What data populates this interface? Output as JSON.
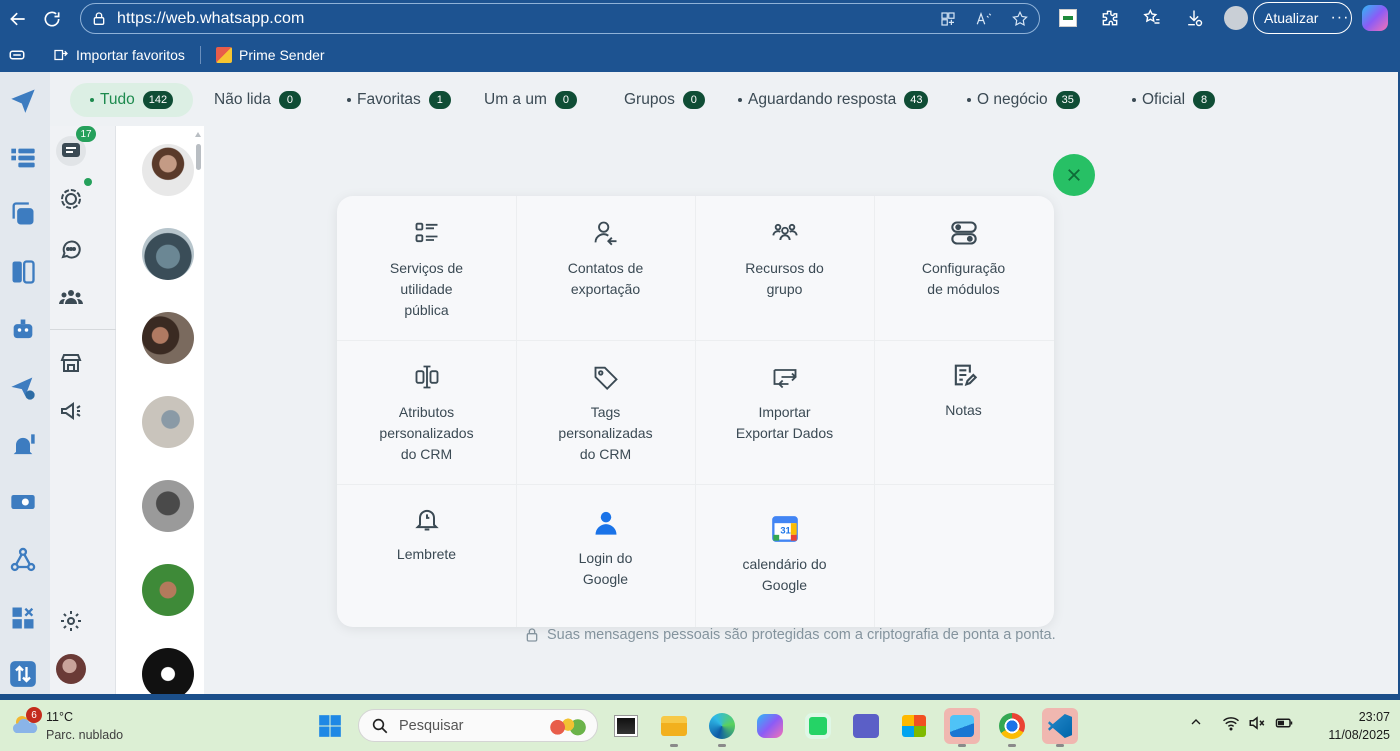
{
  "browser": {
    "url": "https://web.whatsapp.com",
    "update_label": "Atualizar",
    "more_label": "···",
    "bookmarks": [
      {
        "label": "Importar favoritos"
      },
      {
        "label": "Prime Sender"
      }
    ]
  },
  "filters": [
    {
      "label": "Tudo",
      "count": "142",
      "active": true,
      "dot": true
    },
    {
      "label": "Não lida",
      "count": "0",
      "dot": false
    },
    {
      "label": "Favoritas",
      "count": "1",
      "dot": true
    },
    {
      "label": "Um a um",
      "count": "0",
      "dot": false
    },
    {
      "label": "Grupos",
      "count": "0",
      "dot": false
    },
    {
      "label": "Aguardando resposta",
      "count": "43",
      "dot": true
    },
    {
      "label": "O negócio",
      "count": "35",
      "dot": true
    },
    {
      "label": "Oficial",
      "count": "8",
      "dot": true
    }
  ],
  "rail": {
    "chats_badge": "17"
  },
  "modal": {
    "items": [
      {
        "label": "Serviços de utilidade pública",
        "icon": "list-icon"
      },
      {
        "label": "Contatos de exportação",
        "icon": "user-export-icon"
      },
      {
        "label": "Recursos do grupo",
        "icon": "group-icon"
      },
      {
        "label": "Configuração de módulos",
        "icon": "toggles-icon"
      },
      {
        "label": "Atributos personalizados do CRM",
        "icon": "text-cursor-icon"
      },
      {
        "label": "Tags personalizadas do CRM",
        "icon": "tag-icon"
      },
      {
        "label": "Importar Exportar Dados",
        "icon": "import-export-icon"
      },
      {
        "label": "Notas",
        "icon": "notes-icon"
      },
      {
        "label": "Lembrete",
        "icon": "bell-icon"
      },
      {
        "label": "Login do Google",
        "icon": "google-user-icon"
      },
      {
        "label": "calendário do Google",
        "icon": "google-calendar-icon"
      }
    ]
  },
  "encryption_notice": "Suas mensagens pessoais são protegidas com a criptografia de ponta a ponta.",
  "taskbar": {
    "weather_temp": "11°C",
    "weather_condition": "Parc. nublado",
    "weather_badge": "6",
    "search_placeholder": "Pesquisar",
    "time": "23:07",
    "date": "11/08/2025"
  },
  "colors": {
    "browser_chrome": "#1d5391",
    "accent_green": "#27c065",
    "badge_dark_green": "#0f4d35",
    "taskbar": "#dcefd4"
  }
}
